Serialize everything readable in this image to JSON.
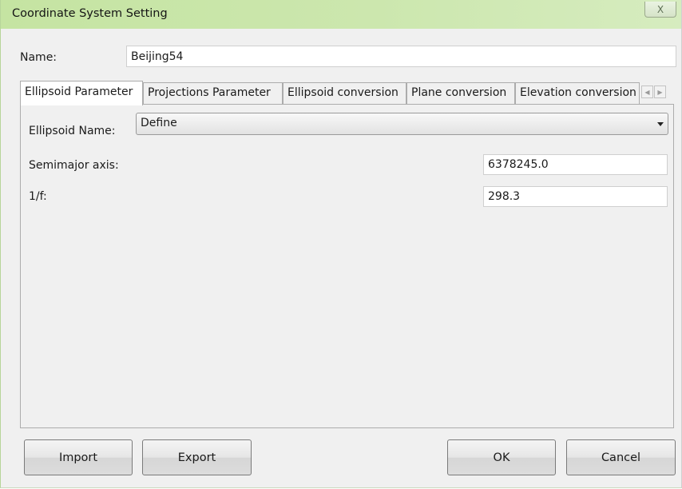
{
  "window": {
    "title": "Coordinate System Setting",
    "close_glyph": "X",
    "titlebar_color": "#c8e5a8"
  },
  "name_row": {
    "label": "Name:",
    "value": "Beijing54"
  },
  "tabs": [
    {
      "label": "Ellipsoid Parameter",
      "active": true
    },
    {
      "label": "Projections Parameter",
      "active": false
    },
    {
      "label": "Ellipsoid conversion",
      "active": false
    },
    {
      "label": "Plane conversion",
      "active": false
    },
    {
      "label": "Elevation conversion",
      "active": false
    }
  ],
  "tab_scroll": {
    "left_icon": "chevron-left-icon",
    "right_icon": "chevron-right-icon"
  },
  "ellipsoid": {
    "name_label": "Ellipsoid Name:",
    "name_value": "Define",
    "semimajor_label": "Semimajor axis:",
    "semimajor_value": "6378245.0",
    "inv_flattening_label": "1/f:",
    "inv_flattening_value": "298.3"
  },
  "buttons": {
    "import": "Import",
    "export": "Export",
    "ok": "OK",
    "cancel": "Cancel"
  }
}
